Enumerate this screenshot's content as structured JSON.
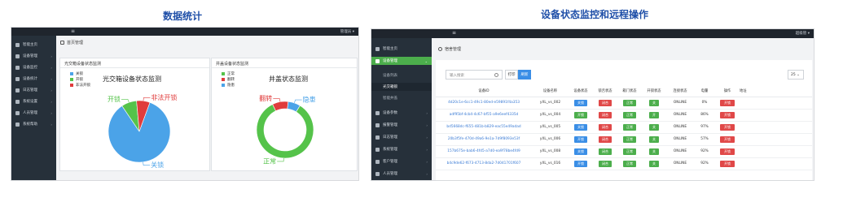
{
  "headings": {
    "left": "数据统计",
    "right": "设备状态监控和远程操作"
  },
  "colors": {
    "close": "#4ba3e8",
    "open": "#55c34a",
    "illegal_open": "#e03c3c",
    "wall": "#e03c3c",
    "hidden_danger": "#4ba3e8"
  },
  "left_panel": {
    "menu_icon": "hamburger-icon",
    "user": "管理员 ▾",
    "sidebar": [
      {
        "label": "智能主页",
        "icon": "home-icon"
      },
      {
        "label": "设备管理",
        "icon": "device-icon"
      },
      {
        "label": "设备监控",
        "icon": "monitor-icon"
      },
      {
        "label": "设备统计",
        "icon": "chart-icon"
      },
      {
        "label": "日志管理",
        "icon": "log-icon"
      },
      {
        "label": "系统设置",
        "icon": "gear-icon"
      },
      {
        "label": "人员管理",
        "icon": "users-icon"
      },
      {
        "label": "系统帮助",
        "icon": "help-icon"
      }
    ],
    "breadcrumb": "首页管理",
    "card1": {
      "title": "光交箱设备状态监测",
      "chart_title": "光交箱设备状态监测",
      "legend": [
        "关锁",
        "开锁",
        "非法开锁"
      ],
      "labels": {
        "open": "开锁",
        "illegal": "非法开锁",
        "close": "关锁"
      }
    },
    "card2": {
      "title": "井盖设备状态监测",
      "chart_title": "井盖状态监测",
      "legend": [
        "正常",
        "翻转",
        "隐患"
      ],
      "labels": {
        "wall": "翻转",
        "hidden": "隐患",
        "normal": "正常"
      }
    }
  },
  "right_panel": {
    "menu_icon": "hamburger-icon",
    "user": "超级管 ▾",
    "sidebar": [
      {
        "label": "智能主页",
        "icon": "home-icon"
      },
      {
        "label": "设备管理",
        "icon": "lock-icon",
        "active": true
      },
      {
        "label": "设备列表",
        "sub": true
      },
      {
        "label": "光交箱锁",
        "sub": true,
        "selected": true
      },
      {
        "label": "智能井盖",
        "sub": true
      },
      {
        "label": "设备参数",
        "icon": "param-icon"
      },
      {
        "label": "报警管理",
        "icon": "warning-icon"
      },
      {
        "label": "日志管理",
        "icon": "log-icon"
      },
      {
        "label": "系统管理",
        "icon": "gear-icon"
      },
      {
        "label": "客户管理",
        "icon": "client-icon"
      },
      {
        "label": "人员管理",
        "icon": "users-icon"
      }
    ],
    "breadcrumb": "宿舍管理",
    "search_placeholder": "输入搜索",
    "print_label": "打印",
    "reset_label": "刷新",
    "page_size": "25",
    "columns": [
      "设备ID",
      "设备名称",
      "设备状态",
      "锁舌状态",
      "箱门状态",
      "开锁状态",
      "连接状态",
      "电量",
      "操作",
      "地址"
    ],
    "rows": [
      {
        "id": "4d20c1e-6cc1-49c1-80ed-e59891f4a353",
        "name": "yXL_vs_002",
        "s1": "关锁",
        "s1c": "blue",
        "s2": "闭合",
        "s2c": "red",
        "s3": "正常",
        "s3c": "green",
        "s4": "关",
        "s4c": "green",
        "conn": "ONLINE",
        "power": "0%",
        "op": "开锁"
      },
      {
        "id": "adf95bf-4cb4-4c67-bf55-a9e6eef4335d",
        "name": "yXL_vs_004",
        "s1": "开锁",
        "s1c": "green",
        "s2": "闭合",
        "s2c": "red",
        "s3": "正常",
        "s3c": "green",
        "s4": "开",
        "s4c": "green",
        "conn": "ONLINE",
        "power": "86%",
        "op": "开锁"
      },
      {
        "id": "bd5668dc-f655-481b-b829-eac55e49adad",
        "name": "yXL_vs_005",
        "s1": "关锁",
        "s1c": "blue",
        "s2": "闭合",
        "s2c": "red",
        "s3": "正常",
        "s3c": "green",
        "s4": "关",
        "s4c": "green",
        "conn": "ONLINE",
        "power": "97%",
        "op": "开锁"
      },
      {
        "id": "20b3f5fe-470d-49a6-9e1a-7d9f8093e53f",
        "name": "yXL_vs_006",
        "s1": "开锁",
        "s1c": "blue",
        "s2": "闭合",
        "s2c": "red",
        "s3": "正常",
        "s3c": "green",
        "s4": "关",
        "s4c": "green",
        "conn": "ONLINE",
        "power": "57%",
        "op": "开锁"
      },
      {
        "id": "157b675e-bab6-4fd5-a7d0-ea9f78be4fd9",
        "name": "yXL_vs_008",
        "s1": "关锁",
        "s1c": "blue",
        "s2": "闭合",
        "s2c": "green",
        "s3": "正常",
        "s3c": "green",
        "s4": "关",
        "s4c": "green",
        "conn": "ONLINE",
        "power": "92%",
        "op": "开锁"
      },
      {
        "id": "b4c9de62-f673-4713-8da2-7d041701f607",
        "name": "yXL_vs_016",
        "s1": "开锁",
        "s1c": "blue",
        "s2": "闭合",
        "s2c": "green",
        "s3": "正常",
        "s3c": "green",
        "s4": "关",
        "s4c": "green",
        "conn": "ONLINE",
        "power": "92%",
        "op": "开锁"
      }
    ]
  },
  "chart_data": [
    {
      "type": "pie",
      "title": "光交箱设备状态监测",
      "categories": [
        "关锁",
        "开锁",
        "非法开锁"
      ],
      "values": [
        85,
        8,
        7
      ]
    },
    {
      "type": "pie",
      "title": "井盖状态监测",
      "categories": [
        "正常",
        "翻转",
        "隐患"
      ],
      "values": [
        84,
        9,
        7
      ]
    }
  ]
}
